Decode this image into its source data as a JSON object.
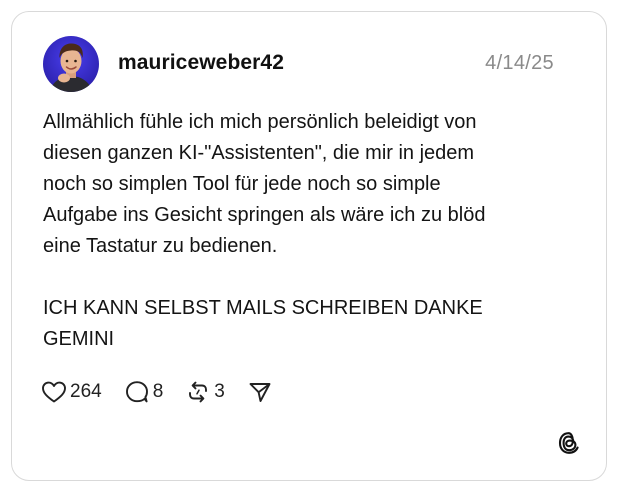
{
  "post": {
    "author": "mauriceweber42",
    "date": "4/14/25",
    "paragraphs": [
      "Allmählich fühle ich mich persönlich beleidigt von\ndiesen ganzen KI-\"Assistenten\", die mir in jedem\nnoch so simplen Tool für jede noch so simple\nAufgabe ins Gesicht springen als wäre ich zu blöd\neine Tastatur zu bedienen.",
      "ICH KANN SELBST MAILS SCHREIBEN DANKE\nGEMINI"
    ]
  },
  "actions": {
    "likes": "264",
    "replies": "8",
    "reposts": "3"
  },
  "icons": {
    "like": "heart-icon",
    "reply": "comment-bubble-icon",
    "repost": "repost-icon",
    "share": "send-icon",
    "brand": "threads-logo-icon"
  },
  "colors": {
    "text": "#111111",
    "muted": "#8a8a8a",
    "border": "#d9d9d9",
    "avatar_bg": "#3b2fd6"
  }
}
